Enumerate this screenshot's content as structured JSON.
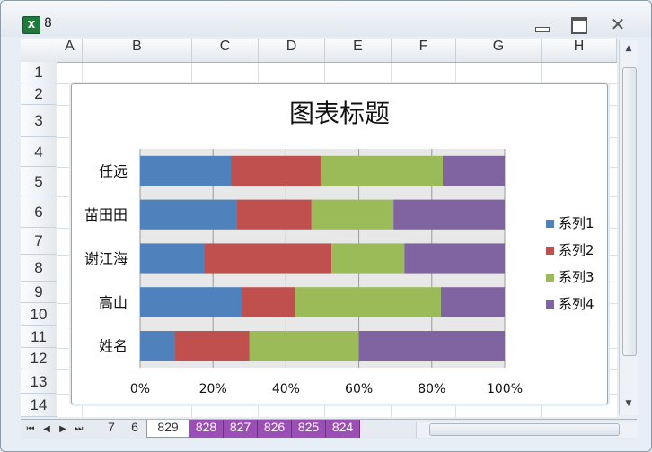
{
  "window": {
    "title": "8",
    "app_icon_letter": "X"
  },
  "columns": [
    "A",
    "B",
    "C",
    "D",
    "E",
    "F",
    "G",
    "H"
  ],
  "rows": [
    "1",
    "2",
    "3",
    "4",
    "5",
    "6",
    "7",
    "8",
    "9",
    "10",
    "11",
    "12",
    "13",
    "14"
  ],
  "chart_data": {
    "type": "bar",
    "orientation": "horizontal",
    "stacked": "percent",
    "title": "图表标题",
    "categories": [
      "姓名",
      "高山",
      "谢江海",
      "苗田田",
      "任远"
    ],
    "series": [
      {
        "name": "系列1",
        "color": "#4f81bd",
        "values": [
          9.5,
          28,
          17.5,
          26.5,
          25
        ]
      },
      {
        "name": "系列2",
        "color": "#c0504d",
        "values": [
          20.5,
          14.5,
          35,
          20.5,
          24.5
        ]
      },
      {
        "name": "系列3",
        "color": "#9bbb59",
        "values": [
          30,
          40,
          20,
          22.5,
          33.5
        ]
      },
      {
        "name": "系列4",
        "color": "#8064a2",
        "values": [
          40,
          17.5,
          27.5,
          30.5,
          17
        ]
      }
    ],
    "x_ticks": [
      "0%",
      "20%",
      "40%",
      "60%",
      "80%",
      "100%"
    ],
    "xlim": [
      0,
      100
    ],
    "grid": true,
    "legend": "right"
  },
  "sheet_tabs": {
    "nav": [
      "⏮",
      "◀",
      "▶",
      "⏭"
    ],
    "items": [
      {
        "label": "7",
        "style": "plain"
      },
      {
        "label": "6",
        "style": "plain"
      },
      {
        "label": "829",
        "style": "active"
      },
      {
        "label": "828",
        "style": "purple"
      },
      {
        "label": "827",
        "style": "purple"
      },
      {
        "label": "826",
        "style": "purple"
      },
      {
        "label": "825",
        "style": "purple"
      },
      {
        "label": "824",
        "style": "purple"
      }
    ]
  }
}
